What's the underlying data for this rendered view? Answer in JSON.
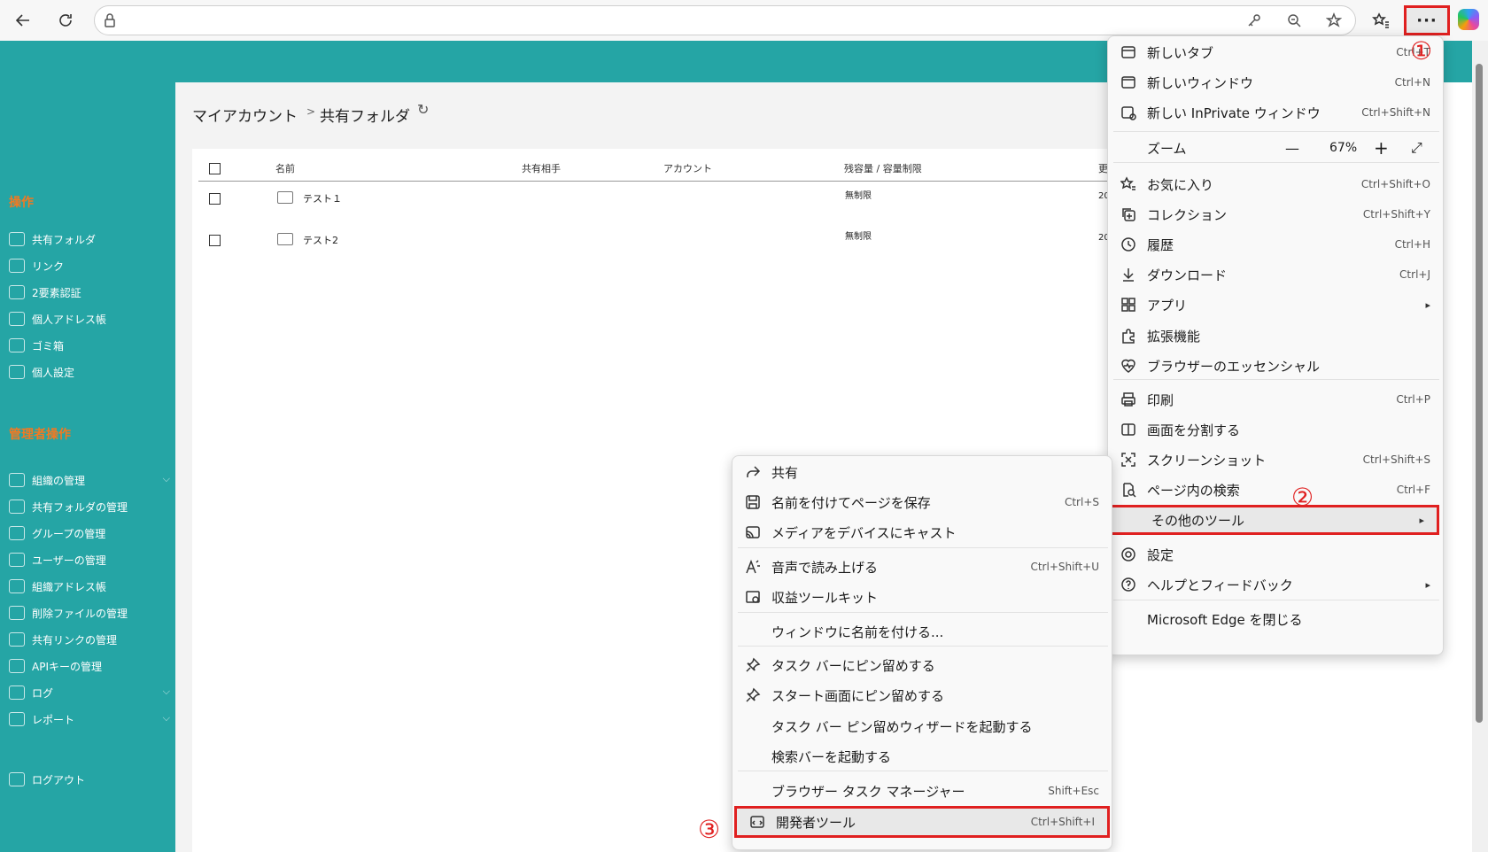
{
  "browser": {
    "zoom_label": "ズーム",
    "zoom_value": "67%",
    "zoom_minus": "—",
    "zoom_plus": "+",
    "more_label": "···"
  },
  "breadcrumb": {
    "root": "マイアカウント",
    "separator": ">",
    "current": "共有フォルダ"
  },
  "sidebar": {
    "section_ops": "操作",
    "ops": [
      {
        "label": "共有フォルダ",
        "icon": "folder-icon"
      },
      {
        "label": "リンク",
        "icon": "link-icon"
      },
      {
        "label": "2要素認証",
        "icon": "lock-icon"
      },
      {
        "label": "個人アドレス帳",
        "icon": "edit-icon"
      },
      {
        "label": "ゴミ箱",
        "icon": "trash-icon"
      },
      {
        "label": "個人設定",
        "icon": "gear-icon"
      }
    ],
    "section_admin": "管理者操作",
    "admin": [
      {
        "label": "組織の管理",
        "icon": "gear-icon"
      },
      {
        "label": "共有フォルダの管理",
        "icon": "folder-icon"
      },
      {
        "label": "グループの管理",
        "icon": "group-icon"
      },
      {
        "label": "ユーザーの管理",
        "icon": "user-icon"
      },
      {
        "label": "組織アドレス帳",
        "icon": "edit-icon"
      },
      {
        "label": "削除ファイルの管理",
        "icon": "trash-icon"
      },
      {
        "label": "共有リンクの管理",
        "icon": "link-icon"
      },
      {
        "label": "APIキーの管理",
        "icon": "lock-icon"
      },
      {
        "label": "ログ",
        "icon": "clock-icon"
      },
      {
        "label": "レポート",
        "icon": "document-icon"
      }
    ],
    "logout": "ログアウト"
  },
  "table": {
    "headers": [
      "名前",
      "共有相手",
      "アカウント",
      "残容量 / 容量制限",
      "更"
    ],
    "rows": [
      {
        "name": "テスト１",
        "quota": "無制限",
        "updated": "20"
      },
      {
        "name": "テスト2",
        "quota": "無制限",
        "updated": "20"
      }
    ]
  },
  "main_menu": [
    {
      "label": "新しいタブ",
      "shortcut": "Ctrl+T",
      "icon": "new-tab-icon"
    },
    {
      "label": "新しいウィンドウ",
      "shortcut": "Ctrl+N",
      "icon": "window-icon"
    },
    {
      "label": "新しい InPrivate ウィンドウ",
      "shortcut": "Ctrl+Shift+N",
      "icon": "inprivate-icon"
    },
    {
      "label": "お気に入り",
      "shortcut": "Ctrl+Shift+O",
      "icon": "favorites-icon"
    },
    {
      "label": "コレクション",
      "shortcut": "Ctrl+Shift+Y",
      "icon": "collections-icon"
    },
    {
      "label": "履歴",
      "shortcut": "Ctrl+H",
      "icon": "history-icon"
    },
    {
      "label": "ダウンロード",
      "shortcut": "Ctrl+J",
      "icon": "download-icon"
    },
    {
      "label": "アプリ",
      "shortcut": "",
      "icon": "apps-icon"
    },
    {
      "label": "拡張機能",
      "shortcut": "",
      "icon": "extensions-icon"
    },
    {
      "label": "ブラウザーのエッセンシャル",
      "shortcut": "",
      "icon": "heart-pulse-icon"
    },
    {
      "label": "印刷",
      "shortcut": "Ctrl+P",
      "icon": "print-icon"
    },
    {
      "label": "画面を分割する",
      "shortcut": "",
      "icon": "split-screen-icon"
    },
    {
      "label": "スクリーンショット",
      "shortcut": "Ctrl+Shift+S",
      "icon": "screenshot-icon"
    },
    {
      "label": "ページ内の検索",
      "shortcut": "Ctrl+F",
      "icon": "find-icon"
    },
    {
      "label": "その他のツール",
      "shortcut": "",
      "icon": ""
    },
    {
      "label": "設定",
      "shortcut": "",
      "icon": "settings-icon"
    },
    {
      "label": "ヘルプとフィードバック",
      "shortcut": "",
      "icon": "help-icon"
    },
    {
      "label": "Microsoft Edge を閉じる",
      "shortcut": "",
      "icon": ""
    }
  ],
  "sub_menu": [
    {
      "label": "共有",
      "shortcut": "",
      "icon": "share-icon"
    },
    {
      "label": "名前を付けてページを保存",
      "shortcut": "Ctrl+S",
      "icon": "save-icon"
    },
    {
      "label": "メディアをデバイスにキャスト",
      "shortcut": "",
      "icon": "cast-icon"
    },
    {
      "label": "音声で読み上げる",
      "shortcut": "Ctrl+Shift+U",
      "icon": "read-aloud-icon"
    },
    {
      "label": "収益ツールキット",
      "shortcut": "",
      "icon": "toolkit-icon"
    },
    {
      "label": "ウィンドウに名前を付ける...",
      "shortcut": "",
      "icon": ""
    },
    {
      "label": "タスク バーにピン留めする",
      "shortcut": "",
      "icon": "pin-icon"
    },
    {
      "label": "スタート画面にピン留めする",
      "shortcut": "",
      "icon": "pin-icon"
    },
    {
      "label": "タスク バー ピン留めウィザードを起動する",
      "shortcut": "",
      "icon": ""
    },
    {
      "label": "検索バーを起動する",
      "shortcut": "",
      "icon": ""
    },
    {
      "label": "ブラウザー タスク マネージャー",
      "shortcut": "Shift+Esc",
      "icon": ""
    },
    {
      "label": "開発者ツール",
      "shortcut": "Ctrl+Shift+I",
      "icon": "devtools-icon"
    }
  ],
  "annotations": {
    "step1": "①",
    "step2": "②",
    "step3": "③",
    "highlight_color": "#e02020"
  },
  "colors": {
    "teal": "#25a5a5",
    "orange": "#f47920"
  }
}
